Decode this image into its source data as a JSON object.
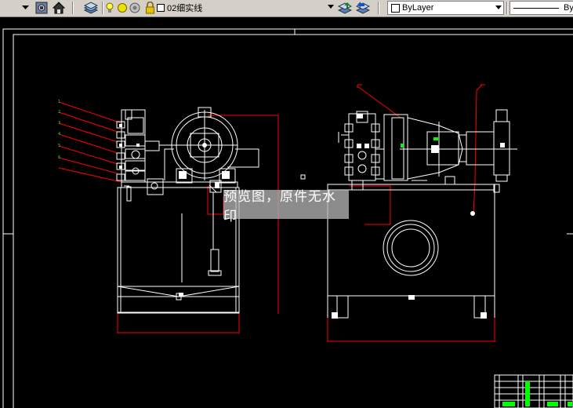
{
  "toolbar": {
    "layer_name": "02细实线",
    "color_value": "ByLayer",
    "linetype_value": "By"
  },
  "watermark": {
    "text": "预览图，原件无水印"
  },
  "colors": {
    "drawing_bg": "#000000",
    "drawing_lines": "#ffffff",
    "dimension_lines": "#ff0000",
    "leader_lines": "#ff0000",
    "highlight_green": "#00ff00",
    "toolbar_bg": "#d4d0c8"
  }
}
